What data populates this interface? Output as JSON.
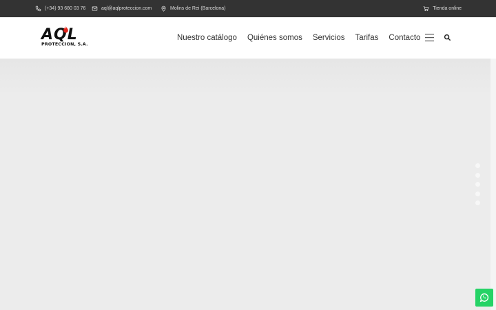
{
  "topbar": {
    "phone": "(+34) 93 680 03 76",
    "email": "aql@aqlproteccion.com",
    "location": "Molins de Rei (Barcelona)",
    "shop": "Tienda online",
    "icons": [
      "phone-icon",
      "mail-icon",
      "location-pin-icon",
      "cart-icon"
    ]
  },
  "logo": {
    "letters": "AQL",
    "subtitle": "PROTECCION, S.A."
  },
  "nav": {
    "items": [
      "Nuestro catálogo",
      "Quiénes somos",
      "Servicios",
      "Tarifas",
      "Contacto"
    ]
  },
  "slider": {
    "dot_count": 5
  },
  "colors": {
    "topbar_bg": "#333333",
    "hero_bg": "#ececec",
    "whatsapp": "#25d366",
    "logo_flame": "#e2231a"
  }
}
